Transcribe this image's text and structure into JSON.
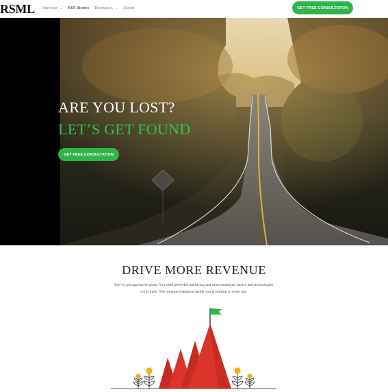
{
  "brand": {
    "logo": "RSML"
  },
  "nav": {
    "items": [
      {
        "label": "Services",
        "has_caret": true,
        "active": false
      },
      {
        "label": "ROI Stories",
        "has_caret": false,
        "active": true
      },
      {
        "label": "Resources",
        "has_caret": true,
        "active": false
      },
      {
        "label": "About",
        "has_caret": false,
        "active": false
      }
    ],
    "caret_glyph": "⌄",
    "cta_label": "GET FREE CONSULTATION"
  },
  "hero": {
    "title_line1": "ARE YOU LOST?",
    "title_line2": "LET’S GET FOUND",
    "cta_label": "GET FREE CONSULTATION"
  },
  "revenue": {
    "title": "DRIVE MORE REVENUE",
    "body": "You’ve got aggressive goals. You need powerful marketing and sales strategies, tactics and technologies to hit them. The revenue champion inside you is waiting to come out."
  },
  "colors": {
    "accent_green": "#2fb34a",
    "mountain_red": "#d9352a",
    "coin_gold": "#f2b01e"
  },
  "icons": [
    "flag-icon",
    "mountain-icon",
    "coin-plant-icon"
  ]
}
